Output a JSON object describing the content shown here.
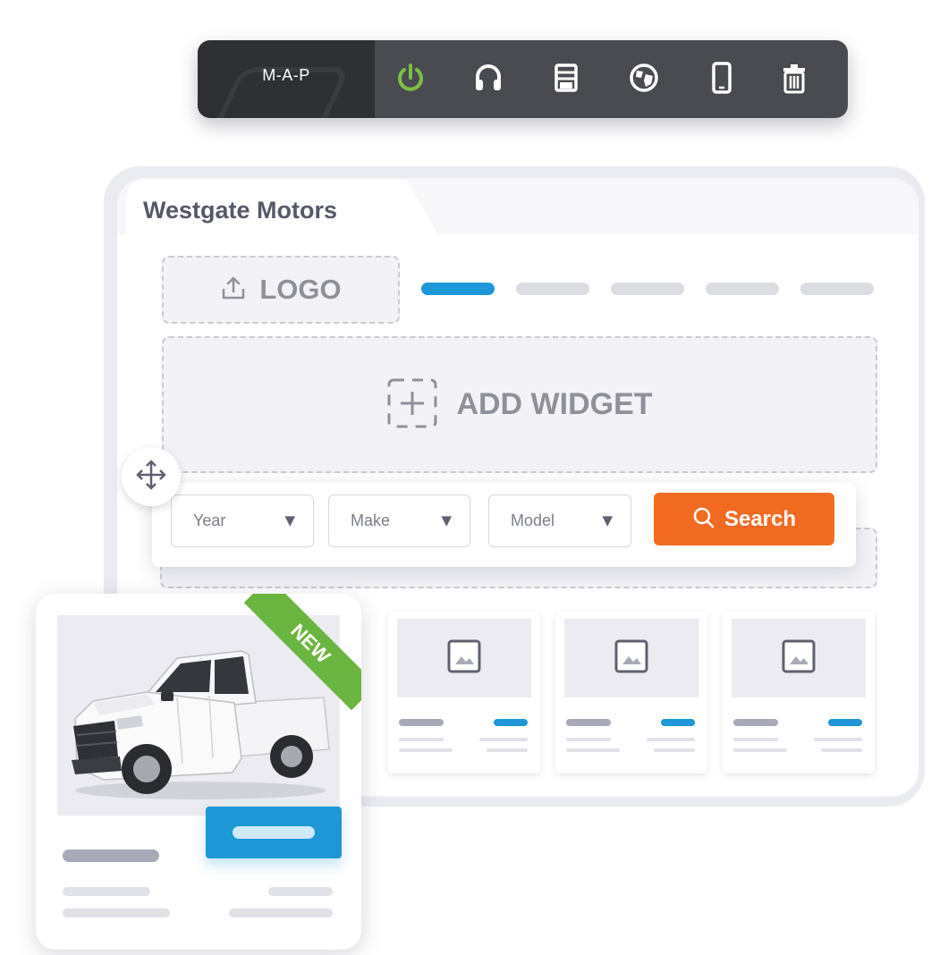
{
  "toolbar": {
    "brand": "M-A-P",
    "icons": [
      "power-icon",
      "headset-icon",
      "save-icon",
      "globe-icon",
      "mobile-icon",
      "trash-icon"
    ],
    "active_color": "#7ac143"
  },
  "site": {
    "title": "Westgate Motors",
    "logo_label": "LOGO",
    "nav_active_color": "#1d97d6",
    "add_widget_label": "ADD WIDGET"
  },
  "search": {
    "year": "Year",
    "make": "Make",
    "model": "Model",
    "button": "Search",
    "button_color": "#f26b21"
  },
  "featured": {
    "badge": "NEW",
    "badge_color": "#6ab53f"
  }
}
